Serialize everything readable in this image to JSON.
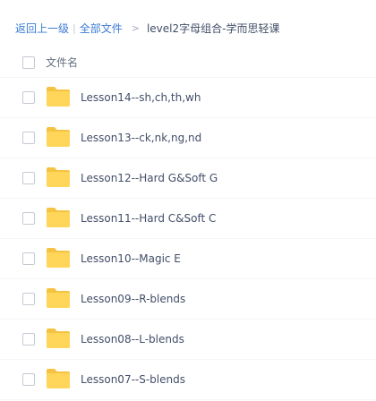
{
  "breadcrumb": {
    "back": "返回上一级",
    "divider": "|",
    "all_files": "全部文件",
    "arrow": ">",
    "current": "level2字母组合-学而思轻课"
  },
  "list": {
    "header_label": "文件名",
    "rows": [
      {
        "name": "Lesson14--sh,ch,th,wh",
        "type": "folder"
      },
      {
        "name": "Lesson13--ck,nk,ng,nd",
        "type": "folder"
      },
      {
        "name": "Lesson12--Hard G&Soft G",
        "type": "folder"
      },
      {
        "name": "Lesson11--Hard C&Soft C",
        "type": "folder"
      },
      {
        "name": "Lesson10--Magic E",
        "type": "folder"
      },
      {
        "name": "Lesson09--R-blends",
        "type": "folder"
      },
      {
        "name": "Lesson08--L-blends",
        "type": "folder"
      },
      {
        "name": "Lesson07--S-blends",
        "type": "folder"
      }
    ]
  },
  "colors": {
    "link": "#3a7bd5",
    "folder": "#ffd659",
    "folder_tab": "#f5c342"
  },
  "icons": {
    "row_icon": "folder-icon",
    "checkbox": "checkbox-icon"
  }
}
